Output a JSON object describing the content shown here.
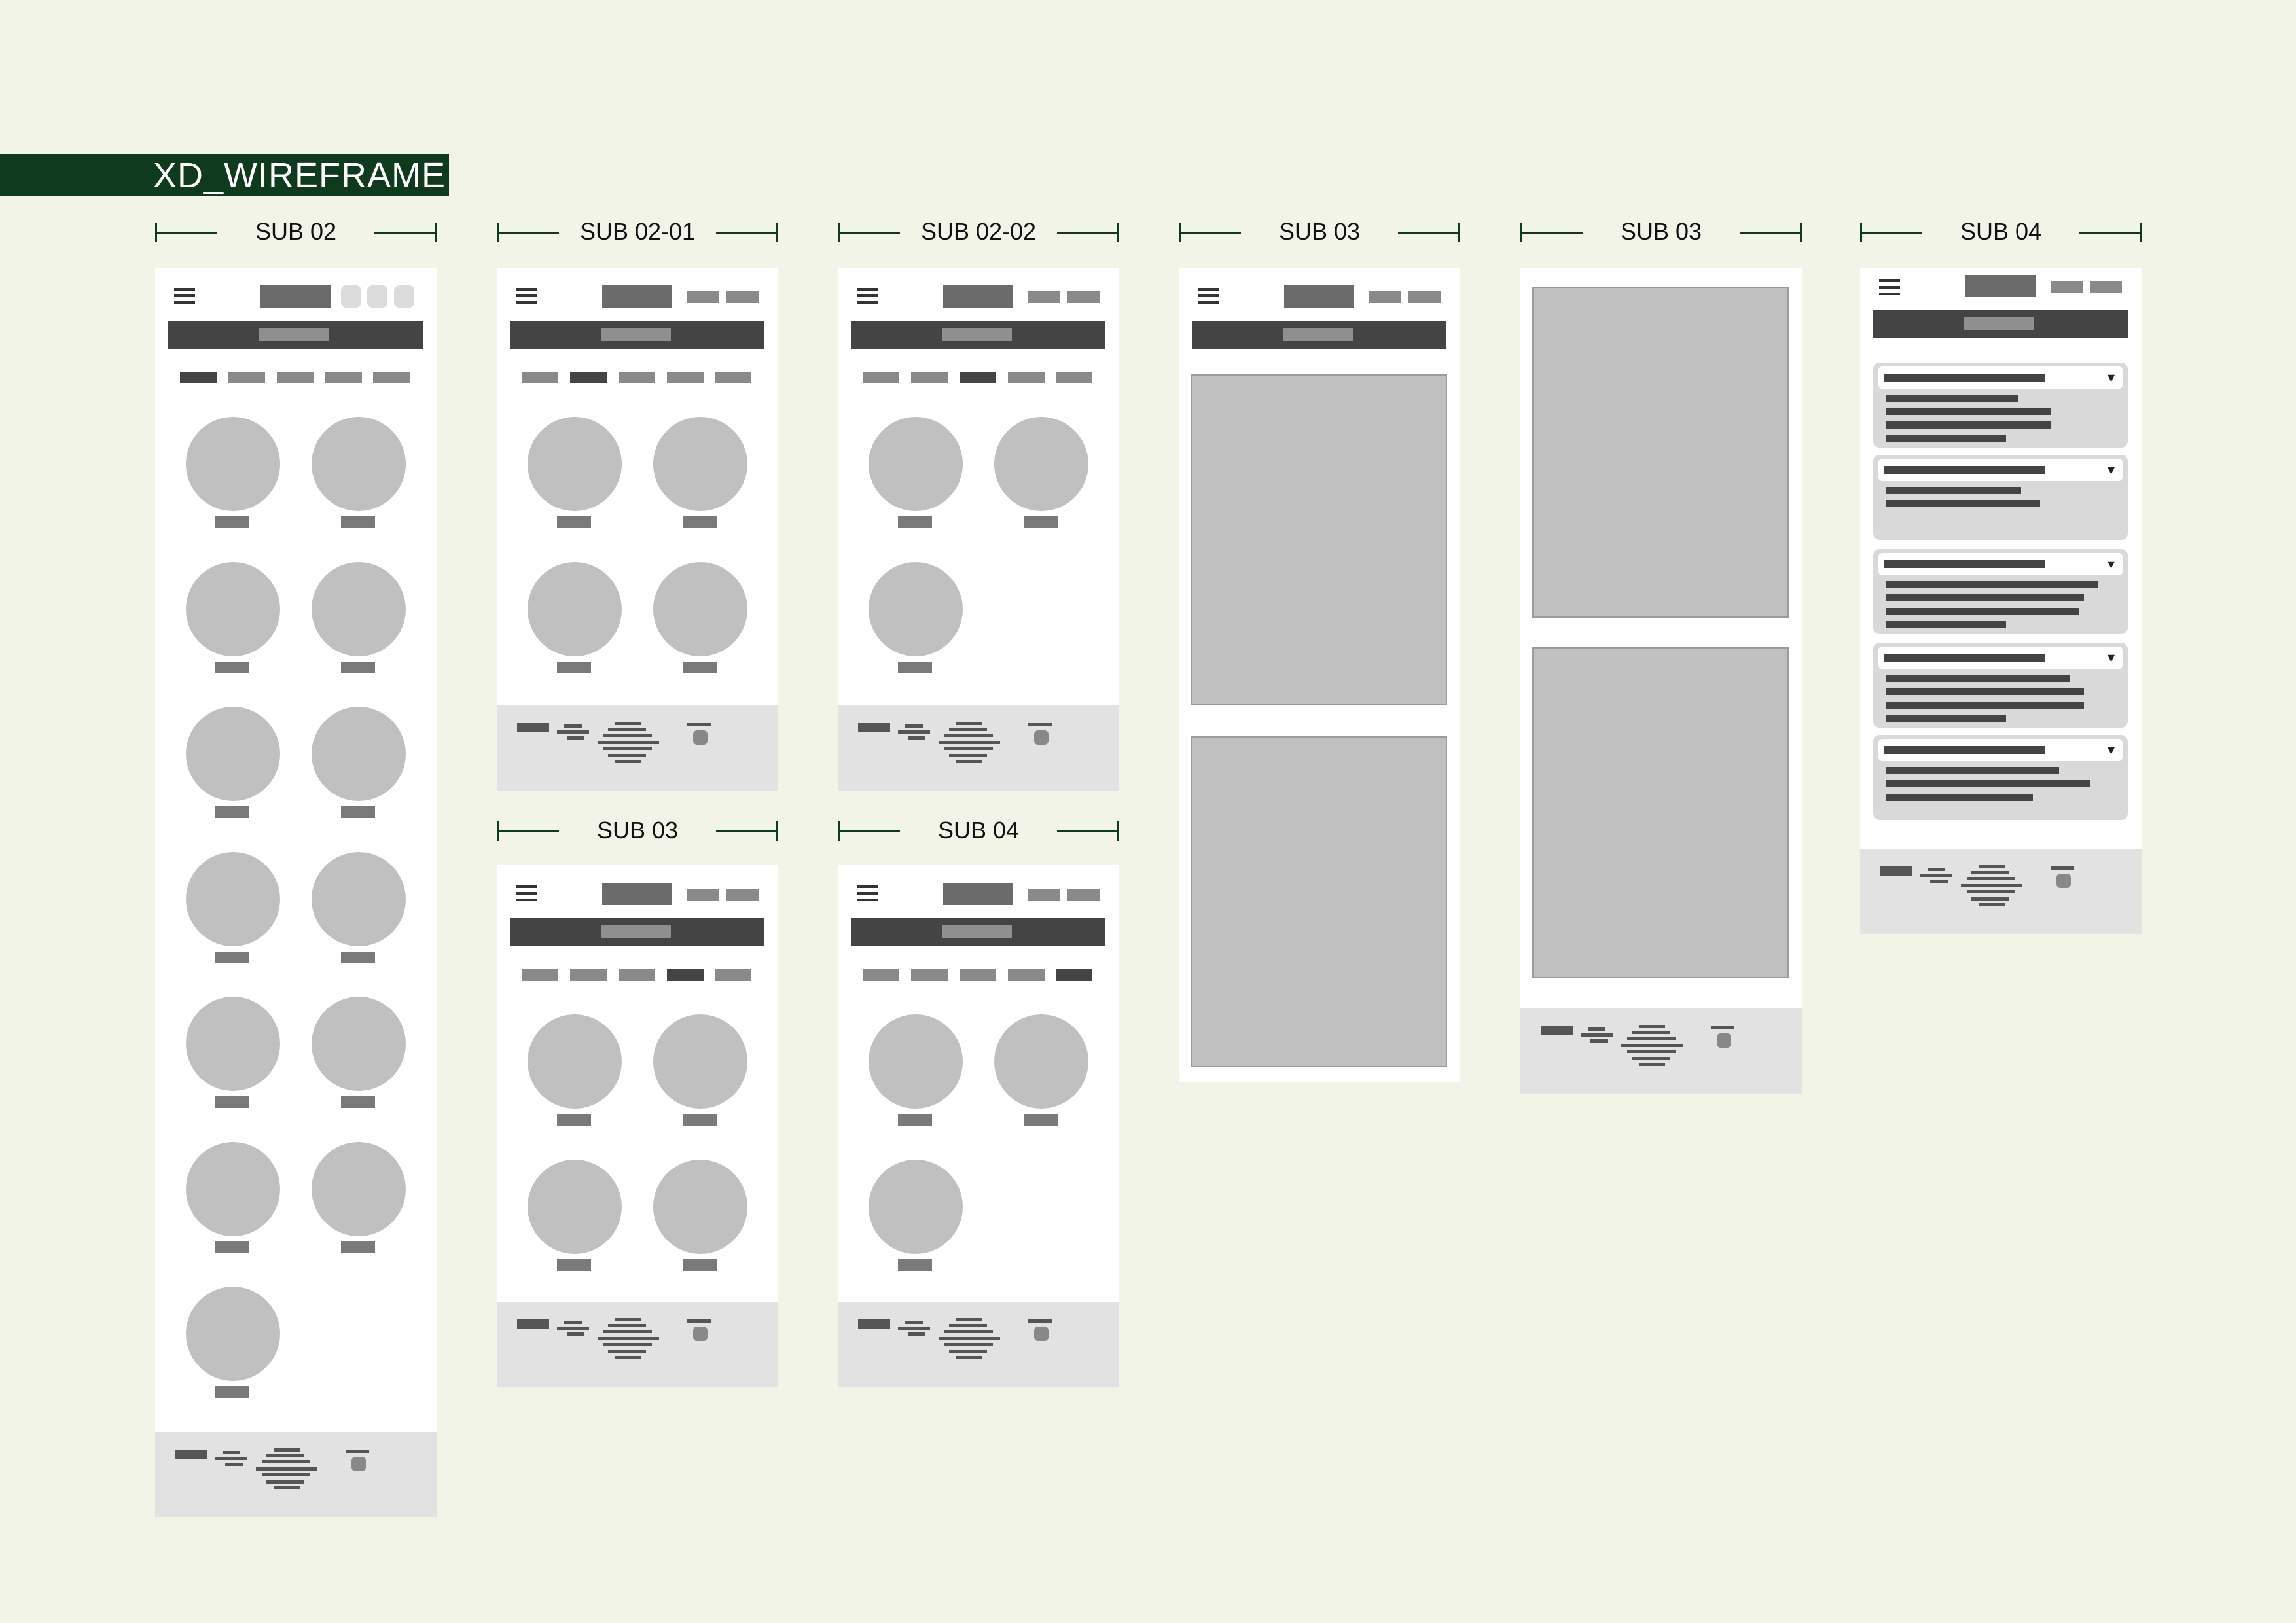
{
  "page": {
    "title": "XD_WIREFRAME"
  },
  "colors": {
    "background": "#f2f4e8",
    "accent": "#0f3a1e",
    "frame": "#ffffff",
    "placeholder": "#c0c0c0",
    "dark": "#444444",
    "footer": "#e2e2e2"
  },
  "screens": [
    {
      "label": "SUB 02",
      "type": "gallery",
      "items": 13,
      "active_tab": 0
    },
    {
      "label": "SUB 02-01",
      "type": "gallery",
      "items": 4,
      "active_tab": 1
    },
    {
      "label": "SUB 02-02",
      "type": "gallery",
      "items": 3,
      "active_tab": 2
    },
    {
      "label": "SUB 03",
      "type": "gallery",
      "items": 4,
      "active_tab": 3
    },
    {
      "label": "SUB 04",
      "type": "gallery",
      "items": 3,
      "active_tab": 4
    },
    {
      "label": "SUB 03",
      "type": "image-detail",
      "images": 2
    },
    {
      "label": "SUB 03",
      "type": "image-detail-no-header",
      "images": 2
    },
    {
      "label": "SUB 04",
      "type": "accordion-faq",
      "accordion_items": 5
    }
  ],
  "icons": {
    "menu": "hamburger-icon",
    "dropdown": "chevron-down-icon"
  }
}
